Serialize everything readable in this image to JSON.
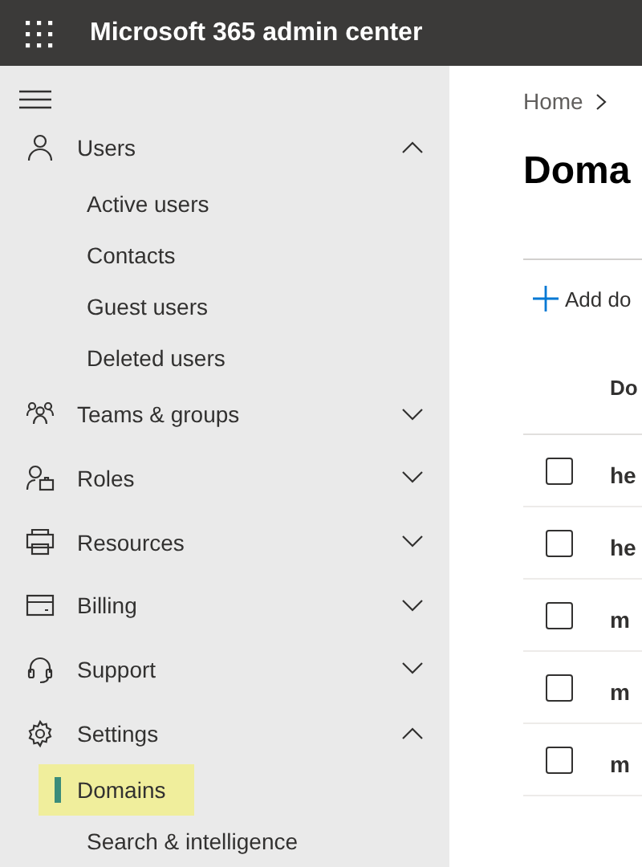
{
  "header": {
    "title": "Microsoft 365 admin center"
  },
  "sidebar": {
    "groups": [
      {
        "label": "Users",
        "expanded": true,
        "children": [
          {
            "label": "Active users",
            "selected": false
          },
          {
            "label": "Contacts",
            "selected": false
          },
          {
            "label": "Guest users",
            "selected": false
          },
          {
            "label": "Deleted users",
            "selected": false
          }
        ]
      },
      {
        "label": "Teams & groups",
        "expanded": false
      },
      {
        "label": "Roles",
        "expanded": false
      },
      {
        "label": "Resources",
        "expanded": false
      },
      {
        "label": "Billing",
        "expanded": false
      },
      {
        "label": "Support",
        "expanded": false
      },
      {
        "label": "Settings",
        "expanded": true,
        "children": [
          {
            "label": "Domains",
            "selected": true
          },
          {
            "label": "Search & intelligence",
            "selected": false
          }
        ]
      }
    ]
  },
  "breadcrumb": [
    "Home"
  ],
  "page_title": "Doma",
  "toolbar": {
    "add_label": "Add do"
  },
  "table": {
    "column_1": "Do",
    "rows": [
      {
        "checked": false,
        "cell": "he"
      },
      {
        "checked": false,
        "cell": "he"
      },
      {
        "checked": false,
        "cell": "m"
      },
      {
        "checked": false,
        "cell": "m"
      },
      {
        "checked": false,
        "cell": "m"
      }
    ]
  }
}
